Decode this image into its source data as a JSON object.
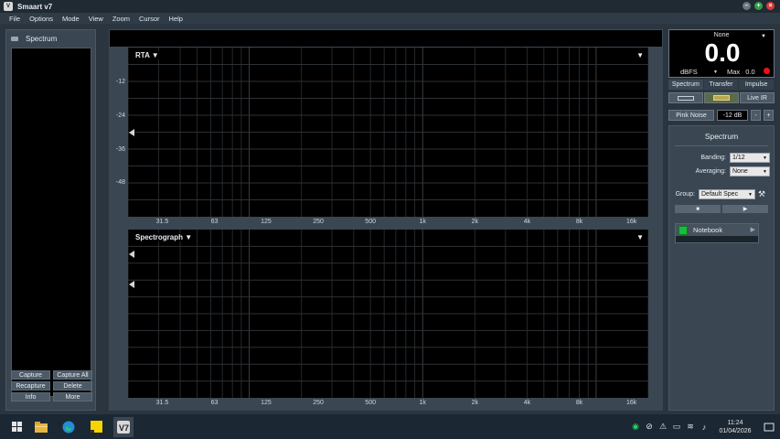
{
  "app": {
    "title": "Smaart v7"
  },
  "menu": [
    "File",
    "Options",
    "Mode",
    "View",
    "Zoom",
    "Cursor",
    "Help"
  ],
  "left_panel": {
    "title": "Spectrum",
    "buttons": [
      "Capture",
      "Capture All",
      "Recapture",
      "Delete",
      "Info",
      "More"
    ]
  },
  "rta": {
    "title": "RTA ▼",
    "menu": "▼",
    "y_ticks": [
      "-12",
      "-24",
      "-36",
      "-48"
    ],
    "x_ticks": [
      "31.5",
      "63",
      "125",
      "250",
      "500",
      "1k",
      "2k",
      "4k",
      "8k",
      "16k"
    ]
  },
  "spectrograph": {
    "title": "Spectrograph ▼",
    "menu": "▼",
    "x_ticks": [
      "31.5",
      "63",
      "125",
      "250",
      "500",
      "1k",
      "2k",
      "4k",
      "8k",
      "16k"
    ]
  },
  "meter": {
    "name": "None",
    "value": "0.0",
    "unit": "dBFS",
    "max_label": "Max",
    "max_value": "0.0"
  },
  "tabs": [
    "Spectrum",
    "Transfer",
    "Impulse"
  ],
  "mode_buttons": {
    "live_ir": "Live IR"
  },
  "pink_noise": {
    "label": "Pink Noise",
    "level": "-12 dB",
    "minus": "-",
    "plus": "+"
  },
  "spectrum_settings": {
    "title": "Spectrum",
    "banding_label": "Banding:",
    "banding_value": "1/12",
    "averaging_label": "Averaging:",
    "averaging_value": "None",
    "group_label": "Group:",
    "group_value": "Default Spec",
    "notebook_label": "Notebook"
  },
  "taskbar": {
    "time": "11:24",
    "date": "01/04/2026"
  }
}
